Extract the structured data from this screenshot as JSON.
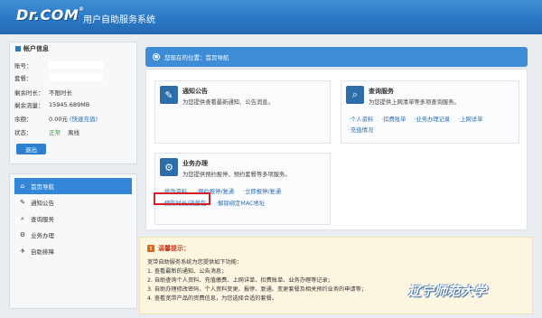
{
  "header": {
    "logo": "Dr.COM",
    "logo_mark": "®",
    "title": "用户自助服务系统"
  },
  "account": {
    "title": "帐户信息",
    "rows": [
      {
        "label": "账号：",
        "value": ""
      },
      {
        "label": "套餐：",
        "value": ""
      },
      {
        "label": "剩余时长：",
        "value": "不限时长"
      },
      {
        "label": "剩余流量：",
        "value": "15945.689MB"
      },
      {
        "label": "余额：",
        "value": "0.00元",
        "extra": "(快速充值)"
      },
      {
        "label": "状态：",
        "value": "正常",
        "extra": "离线"
      }
    ],
    "logout_label": "退出"
  },
  "nav": {
    "items": [
      {
        "label": "首页导航",
        "icon": "home-icon",
        "active": true
      },
      {
        "label": "通知公告",
        "icon": "notice-icon",
        "active": false
      },
      {
        "label": "查询服务",
        "icon": "search-icon",
        "active": false
      },
      {
        "label": "业务办理",
        "icon": "gear-icon",
        "active": false
      },
      {
        "label": "自助排障",
        "icon": "wrench-icon",
        "active": false
      }
    ]
  },
  "breadcrumb": "您现在的位置：首页导航",
  "modules": {
    "notice": {
      "title": "通知公告",
      "desc": "为您提供查看最新通知、公告消息。"
    },
    "query": {
      "title": "查询服务",
      "desc": "为您提供上网清单等多项查询服务。",
      "links": [
        "·个人资料",
        "·扣费账单",
        "·业务办理记录",
        "·上网详单",
        "·充值情况"
      ]
    },
    "business": {
      "title": "业务办理",
      "desc": "为您提供预约报停、预约套餐等多项服务。",
      "links_row1": [
        "·修改资料",
        "·预约报停/复通",
        "·立即报停/复通"
      ],
      "links_row2": [
        "·预购时长/流量包",
        "·解除绑定MAC地址"
      ]
    }
  },
  "tip": {
    "title": "温馨提示：",
    "lines": [
      "宽带自助服务系统为您提供如下功能：",
      "1. 查看最新的通知、公告消息；",
      "2. 自助查询个人资料、充值缴费、上网详单、扣费账单、业务办理等记录；",
      "3. 自助办理修改密码、个人资料变更、报停、复通、变更套餐及相关预约业务的申请等；",
      "4. 查看宽带产品的资费信息，为您选择合适的套餐。"
    ]
  },
  "watermark": "辽宁师范大学"
}
